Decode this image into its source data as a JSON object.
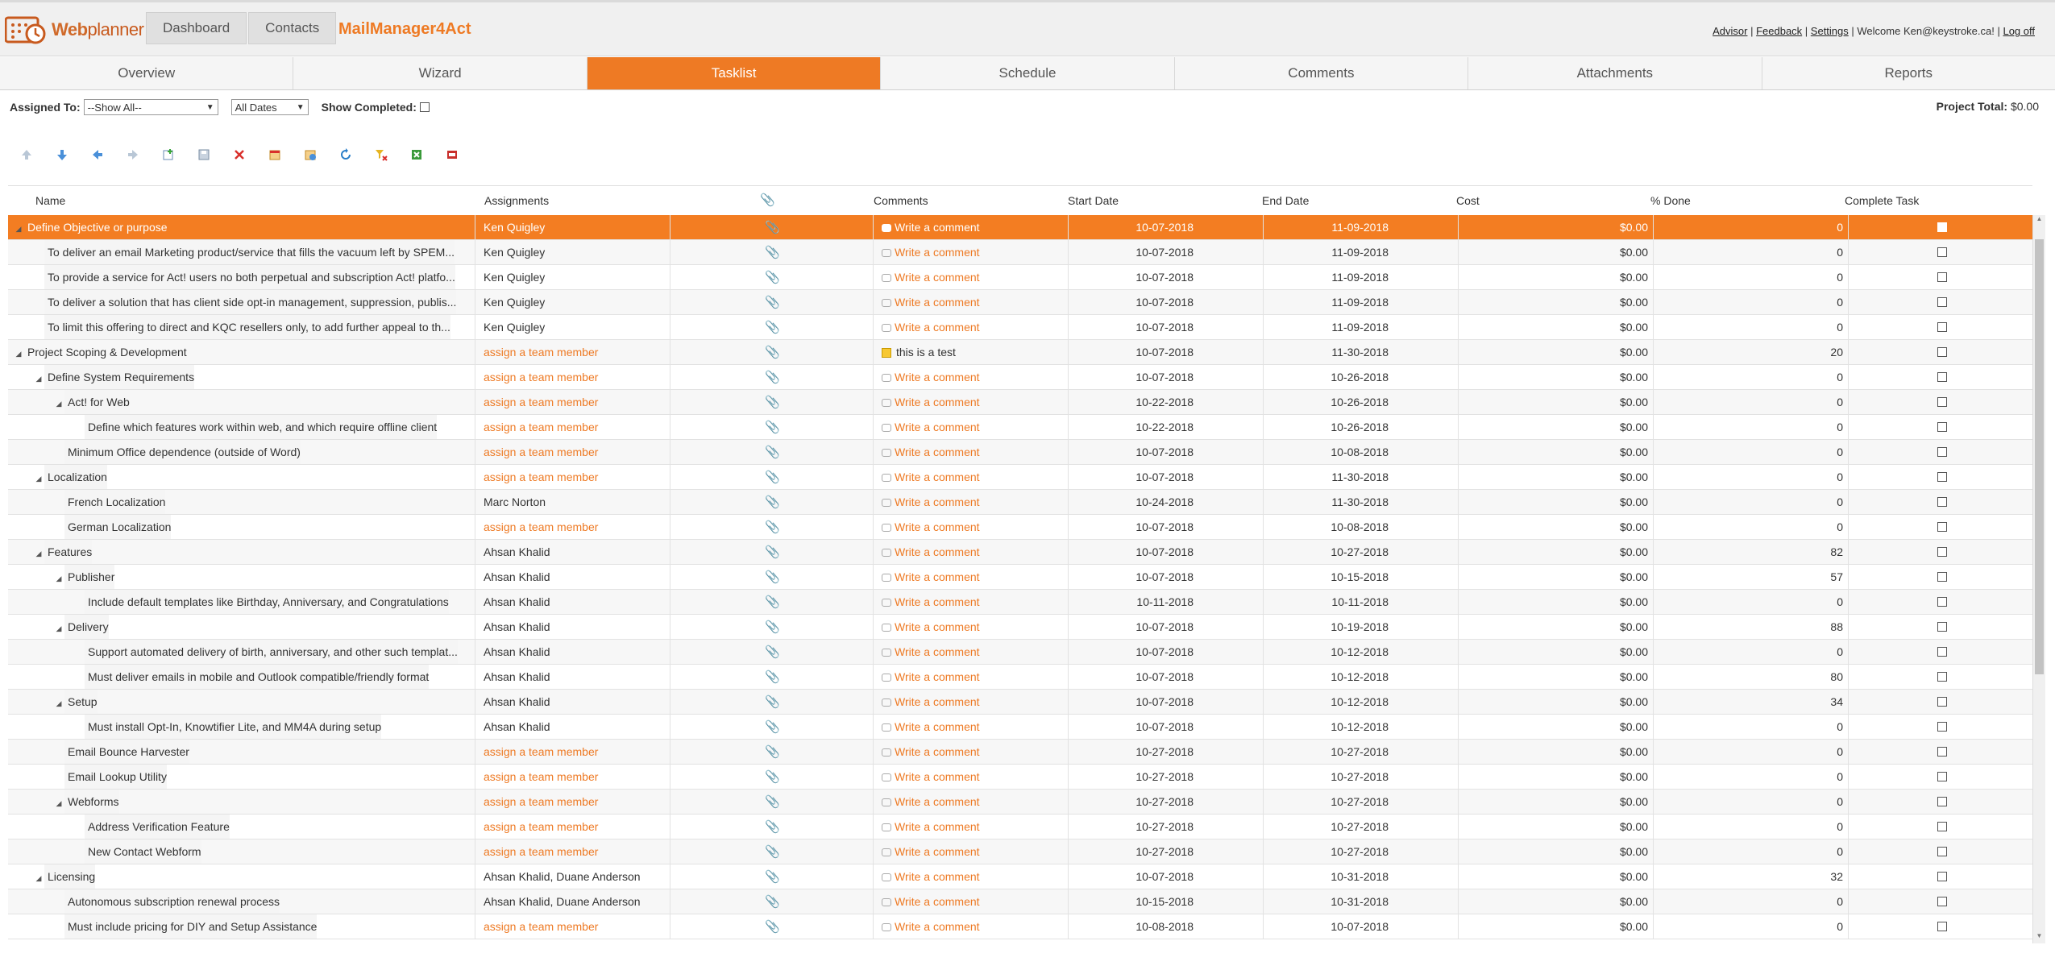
{
  "header": {
    "logo_text": "Web",
    "logo_text2": "planner",
    "nav": [
      "Dashboard",
      "Contacts"
    ],
    "app_name": "MailManager4Act",
    "links": [
      "Advisor",
      "Feedback",
      "Settings"
    ],
    "welcome": "Welcome Ken@keystroke.ca!",
    "logoff": "Log off"
  },
  "tabs": [
    "Overview",
    "Wizard",
    "Tasklist",
    "Schedule",
    "Comments",
    "Attachments",
    "Reports"
  ],
  "active_tab": "Tasklist",
  "filters": {
    "assigned_label": "Assigned To:",
    "assigned_value": "--Show All--",
    "dates_value": "All Dates",
    "show_completed_label": "Show Completed:"
  },
  "project_total": {
    "label": "Project Total:",
    "value": "$0.00"
  },
  "toolbar_icons": [
    "move-up-icon",
    "move-down-icon",
    "outdent-icon",
    "indent-icon",
    "add-task-icon",
    "save-icon",
    "delete-icon",
    "calendar-icon",
    "assign-icon",
    "refresh-icon",
    "clear-filter-icon",
    "export-excel-icon",
    "export-pdf-icon"
  ],
  "columns": [
    "Name",
    "Assignments",
    "",
    "Comments",
    "Start Date",
    "End Date",
    "Cost",
    "% Done",
    "Complete Task"
  ],
  "rows": [
    {
      "name": "Define Objective or purpose",
      "level": 0,
      "toggle": true,
      "assign": "Ken Quigley",
      "assign_link": false,
      "comment": "Write a comment",
      "comment_type": "new",
      "start": "10-07-2018",
      "end": "11-09-2018",
      "cost": "$0.00",
      "pct": "0"
    },
    {
      "name": "To deliver an email Marketing product/service that fills the vacuum left by SPEM...",
      "level": 1,
      "toggle": false,
      "assign": "Ken Quigley",
      "assign_link": false,
      "comment": "Write a comment",
      "comment_type": "new",
      "start": "10-07-2018",
      "end": "11-09-2018",
      "cost": "$0.00",
      "pct": "0"
    },
    {
      "name": "To provide a service for Act! users no both perpetual and subscription Act! platfo...",
      "level": 1,
      "toggle": false,
      "assign": "Ken Quigley",
      "assign_link": false,
      "comment": "Write a comment",
      "comment_type": "new",
      "start": "10-07-2018",
      "end": "11-09-2018",
      "cost": "$0.00",
      "pct": "0"
    },
    {
      "name": "To deliver a solution that has client side opt-in management, suppression, publis...",
      "level": 1,
      "toggle": false,
      "assign": "Ken Quigley",
      "assign_link": false,
      "comment": "Write a comment",
      "comment_type": "new",
      "start": "10-07-2018",
      "end": "11-09-2018",
      "cost": "$0.00",
      "pct": "0"
    },
    {
      "name": "To limit this offering to direct and KQC resellers only, to add further appeal to th...",
      "level": 1,
      "toggle": false,
      "assign": "Ken Quigley",
      "assign_link": false,
      "comment": "Write a comment",
      "comment_type": "new",
      "start": "10-07-2018",
      "end": "11-09-2018",
      "cost": "$0.00",
      "pct": "0"
    },
    {
      "name": "Project Scoping & Development",
      "level": 0,
      "toggle": true,
      "assign": "assign a team member",
      "assign_link": true,
      "comment": "this is a test",
      "comment_type": "note",
      "start": "10-07-2018",
      "end": "11-30-2018",
      "cost": "$0.00",
      "pct": "20"
    },
    {
      "name": "Define System Requirements",
      "level": 1,
      "toggle": true,
      "assign": "assign a team member",
      "assign_link": true,
      "comment": "Write a comment",
      "comment_type": "new",
      "start": "10-07-2018",
      "end": "10-26-2018",
      "cost": "$0.00",
      "pct": "0"
    },
    {
      "name": "Act! for Web",
      "level": 2,
      "toggle": true,
      "assign": "assign a team member",
      "assign_link": true,
      "comment": "Write a comment",
      "comment_type": "new",
      "start": "10-22-2018",
      "end": "10-26-2018",
      "cost": "$0.00",
      "pct": "0"
    },
    {
      "name": "Define which features work within web, and which require offline client",
      "level": 3,
      "toggle": false,
      "assign": "assign a team member",
      "assign_link": true,
      "comment": "Write a comment",
      "comment_type": "new",
      "start": "10-22-2018",
      "end": "10-26-2018",
      "cost": "$0.00",
      "pct": "0"
    },
    {
      "name": "Minimum Office dependence (outside of Word)",
      "level": 2,
      "toggle": false,
      "assign": "assign a team member",
      "assign_link": true,
      "comment": "Write a comment",
      "comment_type": "new",
      "start": "10-07-2018",
      "end": "10-08-2018",
      "cost": "$0.00",
      "pct": "0"
    },
    {
      "name": "Localization",
      "level": 1,
      "toggle": true,
      "assign": "assign a team member",
      "assign_link": true,
      "comment": "Write a comment",
      "comment_type": "new",
      "start": "10-07-2018",
      "end": "11-30-2018",
      "cost": "$0.00",
      "pct": "0"
    },
    {
      "name": "French Localization",
      "level": 2,
      "toggle": false,
      "assign": "Marc Norton",
      "assign_link": false,
      "comment": "Write a comment",
      "comment_type": "new",
      "start": "10-24-2018",
      "end": "11-30-2018",
      "cost": "$0.00",
      "pct": "0"
    },
    {
      "name": "German Localization",
      "level": 2,
      "toggle": false,
      "assign": "assign a team member",
      "assign_link": true,
      "comment": "Write a comment",
      "comment_type": "new",
      "start": "10-07-2018",
      "end": "10-08-2018",
      "cost": "$0.00",
      "pct": "0"
    },
    {
      "name": "Features",
      "level": 1,
      "toggle": true,
      "assign": "Ahsan Khalid",
      "assign_link": false,
      "comment": "Write a comment",
      "comment_type": "new",
      "start": "10-07-2018",
      "end": "10-27-2018",
      "cost": "$0.00",
      "pct": "82"
    },
    {
      "name": "Publisher",
      "level": 2,
      "toggle": true,
      "assign": "Ahsan Khalid",
      "assign_link": false,
      "comment": "Write a comment",
      "comment_type": "new",
      "start": "10-07-2018",
      "end": "10-15-2018",
      "cost": "$0.00",
      "pct": "57"
    },
    {
      "name": "Include default templates like Birthday, Anniversary, and Congratulations",
      "level": 3,
      "toggle": false,
      "assign": "Ahsan Khalid",
      "assign_link": false,
      "comment": "Write a comment",
      "comment_type": "new",
      "start": "10-11-2018",
      "end": "10-11-2018",
      "cost": "$0.00",
      "pct": "0"
    },
    {
      "name": "Delivery",
      "level": 2,
      "toggle": true,
      "assign": "Ahsan Khalid",
      "assign_link": false,
      "comment": "Write a comment",
      "comment_type": "new",
      "start": "10-07-2018",
      "end": "10-19-2018",
      "cost": "$0.00",
      "pct": "88"
    },
    {
      "name": "Support automated delivery of birth, anniversary, and other such templat...",
      "level": 3,
      "toggle": false,
      "assign": "Ahsan Khalid",
      "assign_link": false,
      "comment": "Write a comment",
      "comment_type": "new",
      "start": "10-07-2018",
      "end": "10-12-2018",
      "cost": "$0.00",
      "pct": "0"
    },
    {
      "name": "Must deliver emails in mobile and Outlook compatible/friendly format",
      "level": 3,
      "toggle": false,
      "assign": "Ahsan Khalid",
      "assign_link": false,
      "comment": "Write a comment",
      "comment_type": "new",
      "start": "10-07-2018",
      "end": "10-12-2018",
      "cost": "$0.00",
      "pct": "80"
    },
    {
      "name": "Setup",
      "level": 2,
      "toggle": true,
      "assign": "Ahsan Khalid",
      "assign_link": false,
      "comment": "Write a comment",
      "comment_type": "new",
      "start": "10-07-2018",
      "end": "10-12-2018",
      "cost": "$0.00",
      "pct": "34"
    },
    {
      "name": "Must install Opt-In, Knowtifier Lite, and MM4A during setup",
      "level": 3,
      "toggle": false,
      "assign": "Ahsan Khalid",
      "assign_link": false,
      "comment": "Write a comment",
      "comment_type": "new",
      "start": "10-07-2018",
      "end": "10-12-2018",
      "cost": "$0.00",
      "pct": "0"
    },
    {
      "name": "Email Bounce Harvester",
      "level": 2,
      "toggle": false,
      "assign": "assign a team member",
      "assign_link": true,
      "comment": "Write a comment",
      "comment_type": "new",
      "start": "10-27-2018",
      "end": "10-27-2018",
      "cost": "$0.00",
      "pct": "0"
    },
    {
      "name": "Email Lookup Utility",
      "level": 2,
      "toggle": false,
      "assign": "assign a team member",
      "assign_link": true,
      "comment": "Write a comment",
      "comment_type": "new",
      "start": "10-27-2018",
      "end": "10-27-2018",
      "cost": "$0.00",
      "pct": "0"
    },
    {
      "name": "Webforms",
      "level": 2,
      "toggle": true,
      "assign": "assign a team member",
      "assign_link": true,
      "comment": "Write a comment",
      "comment_type": "new",
      "start": "10-27-2018",
      "end": "10-27-2018",
      "cost": "$0.00",
      "pct": "0"
    },
    {
      "name": "Address Verification Feature",
      "level": 3,
      "toggle": false,
      "assign": "assign a team member",
      "assign_link": true,
      "comment": "Write a comment",
      "comment_type": "new",
      "start": "10-27-2018",
      "end": "10-27-2018",
      "cost": "$0.00",
      "pct": "0"
    },
    {
      "name": "New Contact Webform",
      "level": 3,
      "toggle": false,
      "assign": "assign a team member",
      "assign_link": true,
      "comment": "Write a comment",
      "comment_type": "new",
      "start": "10-27-2018",
      "end": "10-27-2018",
      "cost": "$0.00",
      "pct": "0"
    },
    {
      "name": "Licensing",
      "level": 1,
      "toggle": true,
      "assign": "Ahsan Khalid, Duane Anderson",
      "assign_link": false,
      "comment": "Write a comment",
      "comment_type": "new",
      "start": "10-07-2018",
      "end": "10-31-2018",
      "cost": "$0.00",
      "pct": "32"
    },
    {
      "name": "Autonomous subscription renewal process",
      "level": 2,
      "toggle": false,
      "assign": "Ahsan Khalid, Duane Anderson",
      "assign_link": false,
      "comment": "Write a comment",
      "comment_type": "new",
      "start": "10-15-2018",
      "end": "10-31-2018",
      "cost": "$0.00",
      "pct": "0"
    },
    {
      "name": "Must include pricing for DIY and Setup Assistance",
      "level": 2,
      "toggle": false,
      "assign": "assign a team member",
      "assign_link": true,
      "comment": "Write a comment",
      "comment_type": "new",
      "start": "10-08-2018",
      "end": "10-07-2018",
      "cost": "$0.00",
      "pct": "0"
    }
  ],
  "colors": {
    "accent": "#ee7a24",
    "selected_row": "#f37d22"
  }
}
